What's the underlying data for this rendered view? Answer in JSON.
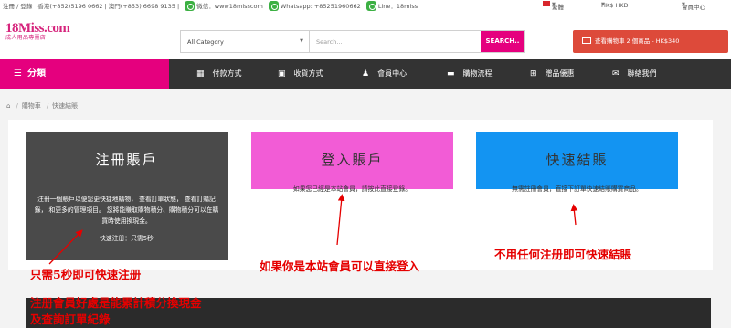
{
  "topbar": {
    "account": "注冊 / 登錄",
    "phones": "香港(+852)5196 0662 | 澳門(+853) 6698 9135 |",
    "wechat": "微信：www18misscom",
    "whatsapp": "Whatsapp: +85251960662",
    "line": "Line：18miss",
    "language": "繁體",
    "currency": "HK$ HKD",
    "member": "會員中心"
  },
  "logo": {
    "main": "18Miss.com",
    "sub": "成人用品專賣店"
  },
  "search": {
    "category": "All Category",
    "placeholder": "Search...",
    "button": "SEARCH.."
  },
  "cart": {
    "label": "查看購物車 2 個商品 - HK$340"
  },
  "nav": {
    "category": "分類",
    "items": [
      {
        "label": "付款方式",
        "icon": "calculator-icon"
      },
      {
        "label": "收貨方式",
        "icon": "box-icon"
      },
      {
        "label": "會員中心",
        "icon": "users-icon"
      },
      {
        "label": "購物流程",
        "icon": "monitor-icon"
      },
      {
        "label": "贈品優惠",
        "icon": "grid-icon"
      },
      {
        "label": "聯絡我們",
        "icon": "mail-icon"
      }
    ]
  },
  "breadcrumb": {
    "home_icon": "home-icon",
    "items": [
      "購物車",
      "快速結賬"
    ]
  },
  "cards": {
    "register": {
      "title": "注冊賬戶",
      "desc": "注冊一個賬戶以便您更快捷地購物， 查看訂單狀態， 查看訂購記錄， 和更多的管理項目。 您將能賺取購物積分、購物積分可以在購買時使用換現金。",
      "quick": "快速注册：只需5秒",
      "color": "#4a4a4a"
    },
    "login": {
      "title": "登入賬戶",
      "desc": "如果您已經是本站會員，請按此直接登錄。",
      "color": "#f25cd6"
    },
    "guest": {
      "title": "快速結賬",
      "desc": "無需註冊會員，直接下訂單快速結賬購買商品。",
      "color": "#1394f2"
    }
  },
  "annotations": {
    "register": "只需5秒即可快速注册",
    "login": "如果你是本站會員可以直接登入",
    "guest": "不用任何注册即可快速結賬",
    "bottom_line1": "注册會員好處是能累計積分換現金",
    "bottom_line2": "及查詢訂單紀錄",
    "color": "#e50000"
  }
}
